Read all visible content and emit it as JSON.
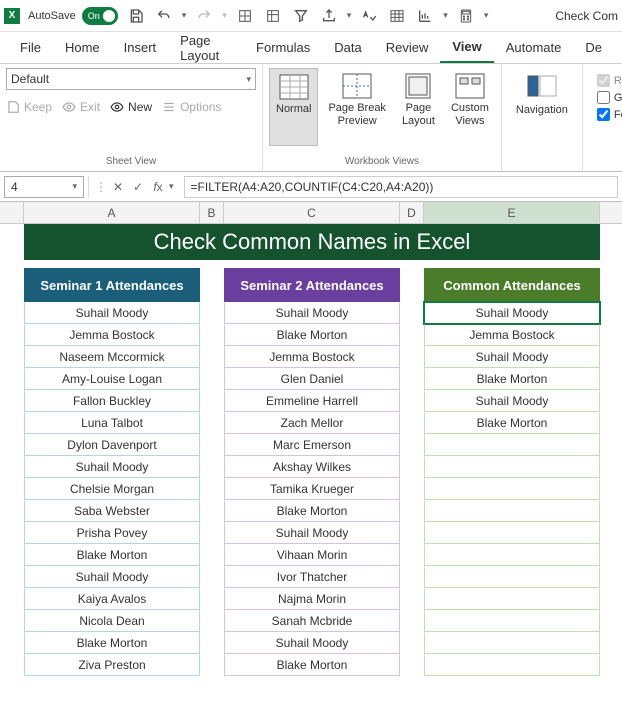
{
  "titlebar": {
    "autosave_label": "AutoSave",
    "autosave_state": "On",
    "document_title": "Check Com"
  },
  "ribbon": {
    "tabs": [
      "File",
      "Home",
      "Insert",
      "Page Layout",
      "Formulas",
      "Data",
      "Review",
      "View",
      "Automate",
      "De"
    ],
    "active_tab": "View",
    "sheet_view": {
      "dropdown_value": "Default",
      "keep": "Keep",
      "exit": "Exit",
      "new": "New",
      "options": "Options",
      "group_label": "Sheet View"
    },
    "workbook_views": {
      "normal": "Normal",
      "page_break": "Page Break\nPreview",
      "page_layout": "Page\nLayout",
      "custom_views": "Custom\nViews",
      "group_label": "Workbook Views"
    },
    "navigation": "Navigation",
    "show": {
      "ruler": "Rul",
      "gridlines": "Gri",
      "formula_bar": "For"
    }
  },
  "formula_bar": {
    "name_box": "4",
    "formula": "=FILTER(A4:A20,COUNTIF(C4:C20,A4:A20))"
  },
  "columns": [
    "A",
    "B",
    "C",
    "D",
    "E"
  ],
  "sheet": {
    "title": "Check Common Names in Excel",
    "headers": {
      "col1": "Seminar 1 Attendances",
      "col2": "Seminar 2 Attendances",
      "col3": "Common Attendances"
    },
    "data": [
      {
        "c1": "Suhail Moody",
        "c2": "Suhail Moody",
        "c3": "Suhail Moody"
      },
      {
        "c1": "Jemma Bostock",
        "c2": "Blake Morton",
        "c3": "Jemma Bostock"
      },
      {
        "c1": "Naseem Mccormick",
        "c2": "Jemma Bostock",
        "c3": "Suhail Moody"
      },
      {
        "c1": "Amy-Louise Logan",
        "c2": "Glen Daniel",
        "c3": "Blake Morton"
      },
      {
        "c1": "Fallon Buckley",
        "c2": "Emmeline Harrell",
        "c3": "Suhail Moody"
      },
      {
        "c1": "Luna Talbot",
        "c2": "Zach Mellor",
        "c3": "Blake Morton"
      },
      {
        "c1": "Dylon Davenport",
        "c2": "Marc Emerson",
        "c3": ""
      },
      {
        "c1": "Suhail Moody",
        "c2": "Akshay Wilkes",
        "c3": ""
      },
      {
        "c1": "Chelsie Morgan",
        "c2": "Tamika Krueger",
        "c3": ""
      },
      {
        "c1": "Saba Webster",
        "c2": "Blake Morton",
        "c3": ""
      },
      {
        "c1": "Prisha Povey",
        "c2": "Suhail Moody",
        "c3": ""
      },
      {
        "c1": "Blake Morton",
        "c2": "Vihaan Morin",
        "c3": ""
      },
      {
        "c1": "Suhail Moody",
        "c2": "Ivor Thatcher",
        "c3": ""
      },
      {
        "c1": "Kaiya Avalos",
        "c2": "Najma Morin",
        "c3": ""
      },
      {
        "c1": "Nicola Dean",
        "c2": "Sanah Mcbride",
        "c3": ""
      },
      {
        "c1": "Blake Morton",
        "c2": "Suhail Moody",
        "c3": ""
      },
      {
        "c1": "Ziva Preston",
        "c2": "Blake Morton",
        "c3": ""
      }
    ]
  }
}
